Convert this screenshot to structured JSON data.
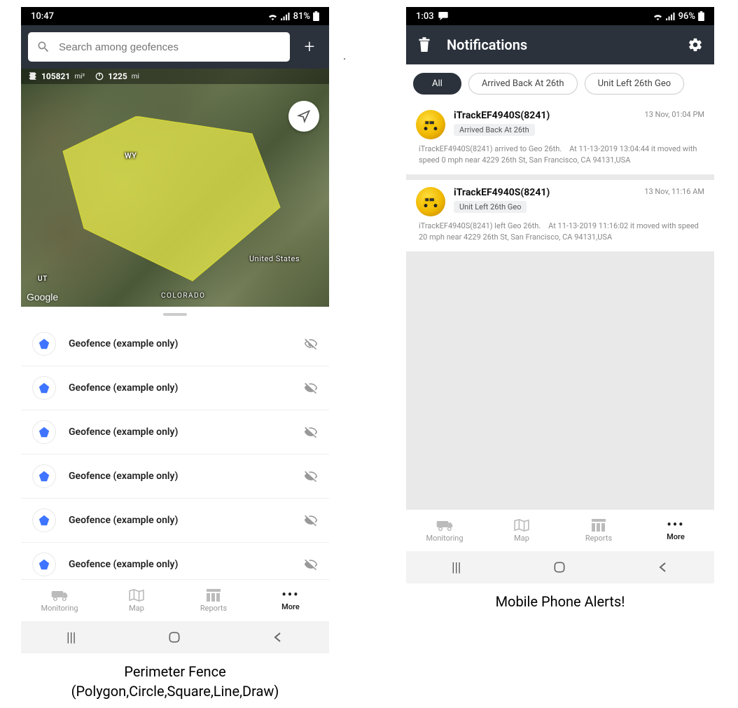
{
  "left": {
    "status": {
      "time": "10:47",
      "battery": "81%"
    },
    "search": {
      "placeholder": "Search among geofences"
    },
    "overlay": {
      "area_val": "105821",
      "area_unit": "mi²",
      "perim_val": "1225",
      "perim_unit": "mi"
    },
    "map_labels": {
      "wy": "WY",
      "ut": "UT",
      "colorado": "COLORADO",
      "us": "United States"
    },
    "google": "Google",
    "geofences": [
      {
        "label": "Geofence (example only)"
      },
      {
        "label": "Geofence (example only)"
      },
      {
        "label": "Geofence (example only)"
      },
      {
        "label": "Geofence (example only)"
      },
      {
        "label": "Geofence (example only)"
      },
      {
        "label": "Geofence (example only)"
      }
    ],
    "nav": {
      "monitoring": "Monitoring",
      "map": "Map",
      "reports": "Reports",
      "more": "More"
    },
    "caption_l1": "Perimeter Fence",
    "caption_l2": "(Polygon,Circle,Square,Line,Draw)"
  },
  "right": {
    "status": {
      "time": "1:03",
      "battery": "96%"
    },
    "header": {
      "title": "Notifications"
    },
    "chips": {
      "all": "All",
      "c1": "Arrived Back At 26th",
      "c2": "Unit Left 26th Geo"
    },
    "cards": [
      {
        "title": "iTrackEF4940S(8241)",
        "tag": "Arrived Back At 26th",
        "time": "13 Nov, 01:04 PM",
        "body": "iTrackEF4940S(8241) arrived to Geo 26th.    At 11-13-2019 13:04:44 it moved with speed 0 mph near 4229 26th St, San Francisco, CA 94131,USA"
      },
      {
        "title": "iTrackEF4940S(8241)",
        "tag": "Unit Left 26th Geo",
        "time": "13 Nov, 11:16 AM",
        "body": "iTrackEF4940S(8241) left Geo 26th.    At 11-13-2019 11:16:02 it moved with speed 20 mph near 4229 26th St, San Francisco, CA 94131,USA"
      }
    ],
    "nav": {
      "monitoring": "Monitoring",
      "map": "Map",
      "reports": "Reports",
      "more": "More"
    },
    "caption": "Mobile Phone Alerts!"
  },
  "icons": {
    "pentagon_color": "#3e74ff",
    "accent_dark": "#2b323c"
  }
}
